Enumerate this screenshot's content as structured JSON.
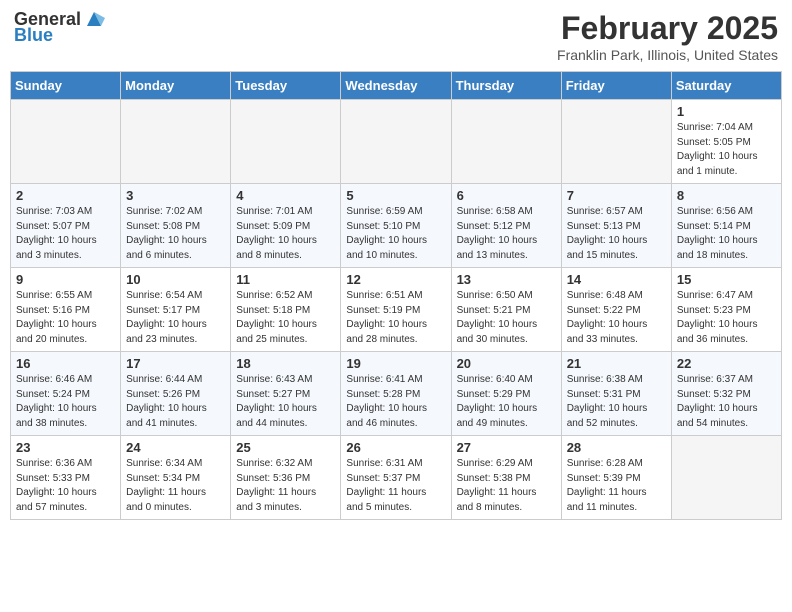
{
  "header": {
    "logo_general": "General",
    "logo_blue": "Blue",
    "month_title": "February 2025",
    "location": "Franklin Park, Illinois, United States"
  },
  "weekdays": [
    "Sunday",
    "Monday",
    "Tuesday",
    "Wednesday",
    "Thursday",
    "Friday",
    "Saturday"
  ],
  "weeks": [
    [
      {
        "day": "",
        "info": ""
      },
      {
        "day": "",
        "info": ""
      },
      {
        "day": "",
        "info": ""
      },
      {
        "day": "",
        "info": ""
      },
      {
        "day": "",
        "info": ""
      },
      {
        "day": "",
        "info": ""
      },
      {
        "day": "1",
        "info": "Sunrise: 7:04 AM\nSunset: 5:05 PM\nDaylight: 10 hours and 1 minute."
      }
    ],
    [
      {
        "day": "2",
        "info": "Sunrise: 7:03 AM\nSunset: 5:07 PM\nDaylight: 10 hours and 3 minutes."
      },
      {
        "day": "3",
        "info": "Sunrise: 7:02 AM\nSunset: 5:08 PM\nDaylight: 10 hours and 6 minutes."
      },
      {
        "day": "4",
        "info": "Sunrise: 7:01 AM\nSunset: 5:09 PM\nDaylight: 10 hours and 8 minutes."
      },
      {
        "day": "5",
        "info": "Sunrise: 6:59 AM\nSunset: 5:10 PM\nDaylight: 10 hours and 10 minutes."
      },
      {
        "day": "6",
        "info": "Sunrise: 6:58 AM\nSunset: 5:12 PM\nDaylight: 10 hours and 13 minutes."
      },
      {
        "day": "7",
        "info": "Sunrise: 6:57 AM\nSunset: 5:13 PM\nDaylight: 10 hours and 15 minutes."
      },
      {
        "day": "8",
        "info": "Sunrise: 6:56 AM\nSunset: 5:14 PM\nDaylight: 10 hours and 18 minutes."
      }
    ],
    [
      {
        "day": "9",
        "info": "Sunrise: 6:55 AM\nSunset: 5:16 PM\nDaylight: 10 hours and 20 minutes."
      },
      {
        "day": "10",
        "info": "Sunrise: 6:54 AM\nSunset: 5:17 PM\nDaylight: 10 hours and 23 minutes."
      },
      {
        "day": "11",
        "info": "Sunrise: 6:52 AM\nSunset: 5:18 PM\nDaylight: 10 hours and 25 minutes."
      },
      {
        "day": "12",
        "info": "Sunrise: 6:51 AM\nSunset: 5:19 PM\nDaylight: 10 hours and 28 minutes."
      },
      {
        "day": "13",
        "info": "Sunrise: 6:50 AM\nSunset: 5:21 PM\nDaylight: 10 hours and 30 minutes."
      },
      {
        "day": "14",
        "info": "Sunrise: 6:48 AM\nSunset: 5:22 PM\nDaylight: 10 hours and 33 minutes."
      },
      {
        "day": "15",
        "info": "Sunrise: 6:47 AM\nSunset: 5:23 PM\nDaylight: 10 hours and 36 minutes."
      }
    ],
    [
      {
        "day": "16",
        "info": "Sunrise: 6:46 AM\nSunset: 5:24 PM\nDaylight: 10 hours and 38 minutes."
      },
      {
        "day": "17",
        "info": "Sunrise: 6:44 AM\nSunset: 5:26 PM\nDaylight: 10 hours and 41 minutes."
      },
      {
        "day": "18",
        "info": "Sunrise: 6:43 AM\nSunset: 5:27 PM\nDaylight: 10 hours and 44 minutes."
      },
      {
        "day": "19",
        "info": "Sunrise: 6:41 AM\nSunset: 5:28 PM\nDaylight: 10 hours and 46 minutes."
      },
      {
        "day": "20",
        "info": "Sunrise: 6:40 AM\nSunset: 5:29 PM\nDaylight: 10 hours and 49 minutes."
      },
      {
        "day": "21",
        "info": "Sunrise: 6:38 AM\nSunset: 5:31 PM\nDaylight: 10 hours and 52 minutes."
      },
      {
        "day": "22",
        "info": "Sunrise: 6:37 AM\nSunset: 5:32 PM\nDaylight: 10 hours and 54 minutes."
      }
    ],
    [
      {
        "day": "23",
        "info": "Sunrise: 6:36 AM\nSunset: 5:33 PM\nDaylight: 10 hours and 57 minutes."
      },
      {
        "day": "24",
        "info": "Sunrise: 6:34 AM\nSunset: 5:34 PM\nDaylight: 11 hours and 0 minutes."
      },
      {
        "day": "25",
        "info": "Sunrise: 6:32 AM\nSunset: 5:36 PM\nDaylight: 11 hours and 3 minutes."
      },
      {
        "day": "26",
        "info": "Sunrise: 6:31 AM\nSunset: 5:37 PM\nDaylight: 11 hours and 5 minutes."
      },
      {
        "day": "27",
        "info": "Sunrise: 6:29 AM\nSunset: 5:38 PM\nDaylight: 11 hours and 8 minutes."
      },
      {
        "day": "28",
        "info": "Sunrise: 6:28 AM\nSunset: 5:39 PM\nDaylight: 11 hours and 11 minutes."
      },
      {
        "day": "",
        "info": ""
      }
    ]
  ]
}
